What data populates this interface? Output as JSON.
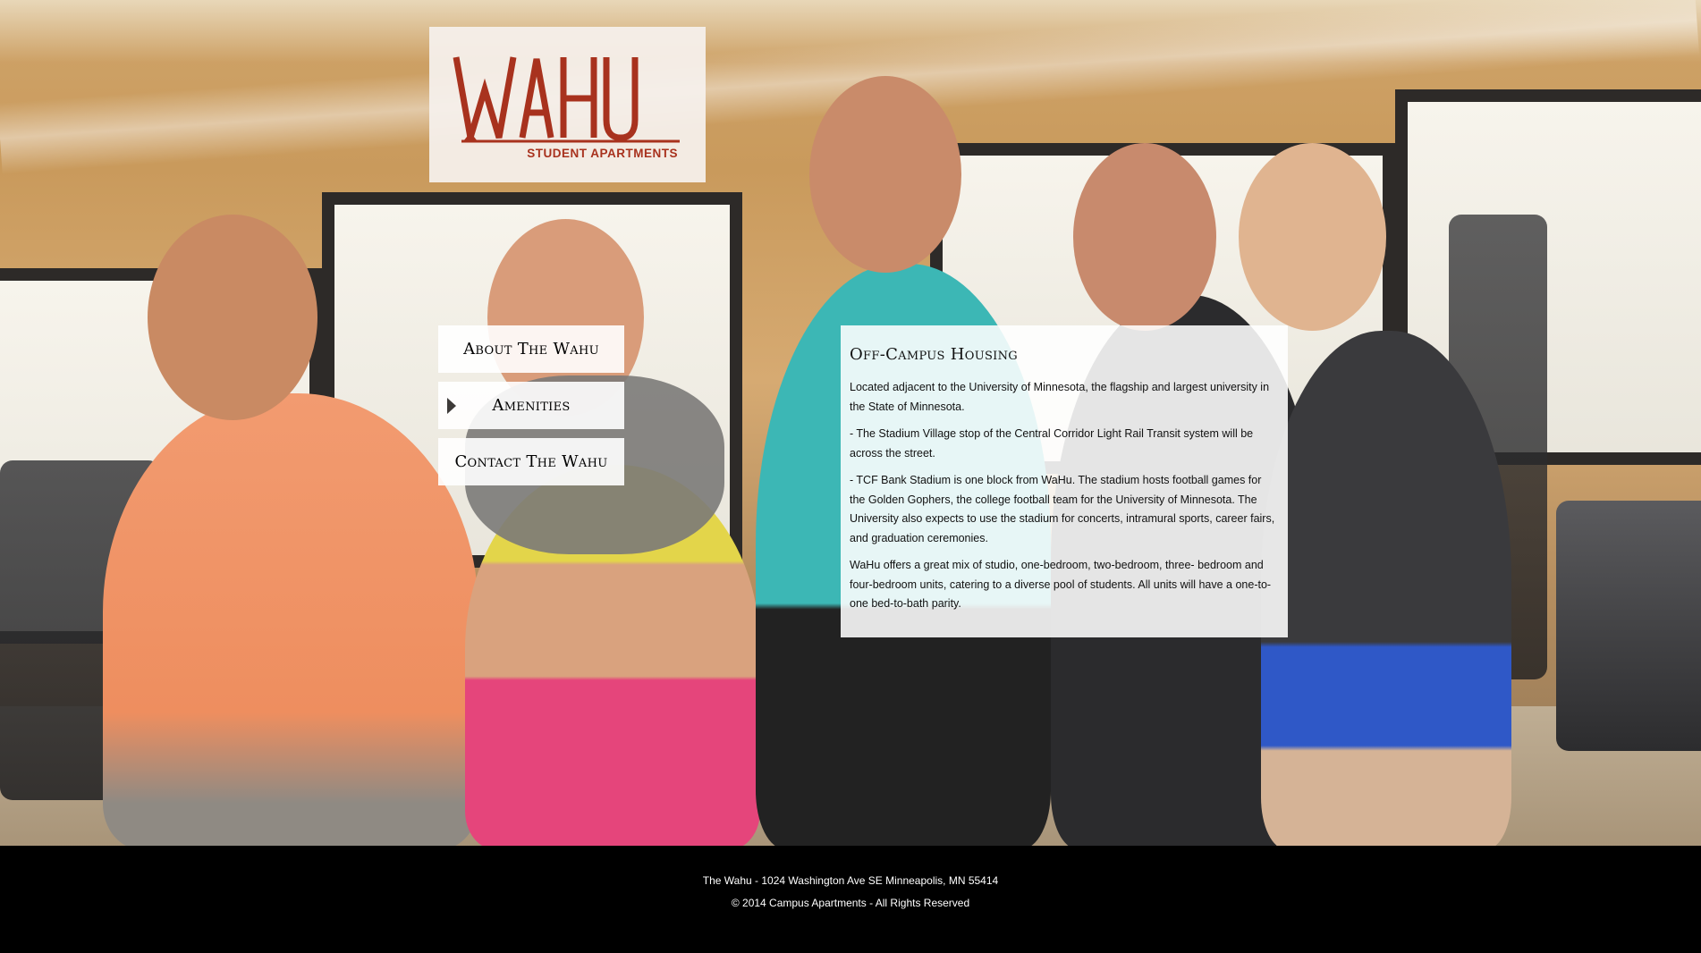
{
  "logo": {
    "wordmark": "WAHU",
    "tagline": "STUDENT APARTMENTS",
    "color": "#a8321e"
  },
  "nav": {
    "items": [
      {
        "label": "About The Wahu",
        "active": false
      },
      {
        "label": "Amenities",
        "active": true
      },
      {
        "label": "Contact The Wahu",
        "active": false
      }
    ]
  },
  "content": {
    "heading": "Off-Campus Housing",
    "paragraphs": [
      "Located adjacent to the University of Minnesota, the flagship and largest university in the State of Minnesota.",
      "- The Stadium Village stop of the Central Corridor Light Rail Transit system will be across the street.",
      "- TCF Bank Stadium is one block from WaHu. The stadium hosts football games for the Golden Gophers, the college football team for the University of Minnesota. The University also expects to use the stadium for concerts, intramural sports, career fairs, and graduation ceremonies.",
      "WaHu offers a great mix of studio, one-bedroom, two-bedroom, three- bedroom and four-bedroom units, catering to a diverse pool of students. All units will have a one-to-one bed-to-bath parity."
    ]
  },
  "footer": {
    "address": "The Wahu - 1024 Washington Ave SE Minneapolis, MN 55414",
    "copyright": "© 2014  Campus Apartments - All Rights Reserved"
  },
  "hero": {
    "image": "students-in-gym-photo",
    "equipment_brand": "TRUE"
  }
}
